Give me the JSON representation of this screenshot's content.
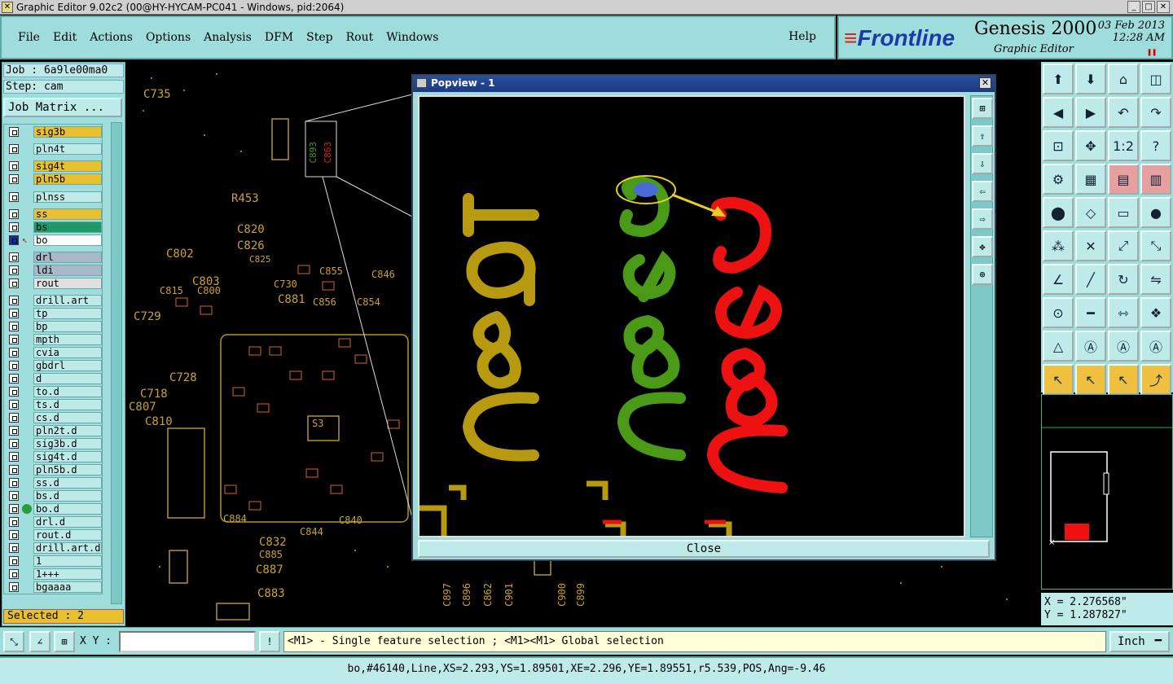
{
  "window": {
    "title": "Graphic Editor 9.02c2 (00@HY-HYCAM-PC041 - Windows, pid:2064)"
  },
  "menu": {
    "items": [
      "File",
      "Edit",
      "Actions",
      "Options",
      "Analysis",
      "DFM",
      "Step",
      "Rout",
      "Windows"
    ],
    "help": "Help"
  },
  "brand": {
    "logo": "Frontline",
    "product": "Genesis 2000",
    "subtitle": "Graphic Editor",
    "date": "03 Feb 2013",
    "time": "12:28 AM"
  },
  "job": {
    "job_label": "Job : 6a9le00ma0",
    "step_label": "Step: cam",
    "matrix_button": "Job Matrix ..."
  },
  "layers": [
    {
      "name": "sig3b",
      "color": "#e8c030"
    },
    {
      "name": "pln4t",
      "color": "#bfeaea"
    },
    {
      "name": "sig4t",
      "color": "#e8c030"
    },
    {
      "name": "pln5b",
      "color": "#e8c030"
    },
    {
      "name": "plnss",
      "color": "#bfeaea"
    },
    {
      "name": "ss",
      "color": "#e8c030"
    },
    {
      "name": "bs",
      "color": "#1e9a6a"
    },
    {
      "name": "bo",
      "color": "#ffffff"
    },
    {
      "name": "drl",
      "color": "#a8b8c8"
    },
    {
      "name": "ldi",
      "color": "#a8b8c8"
    },
    {
      "name": "rout",
      "color": "#e0e0e0"
    },
    {
      "name": "drill.art",
      "color": "#bfeaea"
    },
    {
      "name": "tp",
      "color": "#bfeaea"
    },
    {
      "name": "bp",
      "color": "#bfeaea"
    },
    {
      "name": "mpth",
      "color": "#bfeaea"
    },
    {
      "name": "cvia",
      "color": "#bfeaea"
    },
    {
      "name": "gbdrl",
      "color": "#bfeaea"
    },
    {
      "name": "d",
      "color": "#bfeaea"
    },
    {
      "name": "to.d",
      "color": "#bfeaea"
    },
    {
      "name": "ts.d",
      "color": "#bfeaea"
    },
    {
      "name": "cs.d",
      "color": "#bfeaea"
    },
    {
      "name": "pln2t.d",
      "color": "#bfeaea"
    },
    {
      "name": "sig3b.d",
      "color": "#bfeaea"
    },
    {
      "name": "sig4t.d",
      "color": "#bfeaea"
    },
    {
      "name": "pln5b.d",
      "color": "#bfeaea"
    },
    {
      "name": "ss.d",
      "color": "#bfeaea"
    },
    {
      "name": "bs.d",
      "color": "#bfeaea"
    },
    {
      "name": "bo.d",
      "color": "#bfeaea"
    },
    {
      "name": "drl.d",
      "color": "#bfeaea"
    },
    {
      "name": "rout.d",
      "color": "#bfeaea"
    },
    {
      "name": "drill.art.d",
      "color": "#bfeaea"
    },
    {
      "name": "1",
      "color": "#bfeaea"
    },
    {
      "name": "1+++",
      "color": "#bfeaea"
    },
    {
      "name": "bgaaaa",
      "color": "#bfeaea"
    }
  ],
  "selected_text": "Selected : 2",
  "canvas_labels": [
    "C735",
    "C820",
    "C826",
    "C825",
    "C730",
    "C802",
    "C803",
    "C815",
    "C800",
    "C729",
    "C728",
    "C718",
    "C807",
    "C810",
    "C881",
    "C856",
    "C854",
    "C855",
    "C846",
    "C832",
    "C885",
    "C844",
    "C840",
    "C884",
    "C887",
    "C883",
    "R453",
    "S3",
    "C893",
    "C863",
    "C897",
    "C896",
    "C862",
    "C901",
    "C900",
    "C899"
  ],
  "popview": {
    "title": "Popview - 1",
    "close_label": "Close",
    "labels": [
      {
        "text": "C891",
        "color": "#b89a10"
      },
      {
        "text": "C893",
        "color": "#4a9a18"
      },
      {
        "text": "C863",
        "color": "#ee1111"
      }
    ]
  },
  "coords": {
    "x": "X = 2.276568\"",
    "y": "Y = 1.287827\""
  },
  "bottom": {
    "xy_label": "X Y :",
    "xy_value": "",
    "message": "<M1> - Single feature selection ; <M1><M1> Global selection",
    "unit": "Inch"
  },
  "status_line": "bo,#46140,Line,XS=2.293,YS=1.89501,XE=2.296,YE=1.89551,r5.539,POS,Ang=-9.46"
}
